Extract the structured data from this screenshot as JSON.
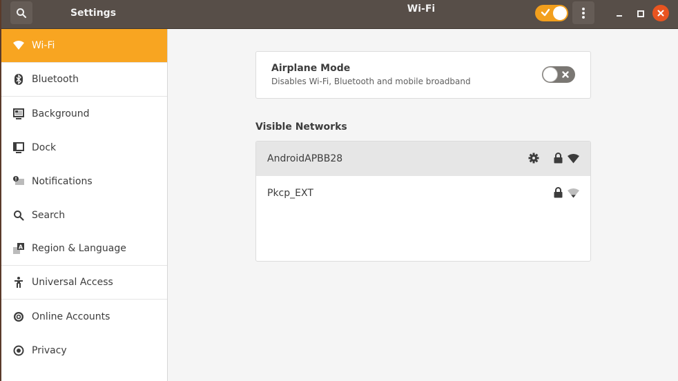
{
  "header": {
    "app_title": "Settings",
    "page_title": "Wi-Fi",
    "search_icon": "search-icon",
    "wifi_enabled": true,
    "menu_icon": "vertical-ellipsis-icon",
    "window_controls": [
      "minimize",
      "maximize",
      "close"
    ]
  },
  "sidebar": {
    "items": [
      {
        "label": "Wi-Fi",
        "icon": "wifi-icon",
        "active": true
      },
      {
        "label": "Bluetooth",
        "icon": "bluetooth-icon"
      },
      {
        "label": "Background",
        "icon": "background-icon"
      },
      {
        "label": "Dock",
        "icon": "dock-icon"
      },
      {
        "label": "Notifications",
        "icon": "notifications-icon"
      },
      {
        "label": "Search",
        "icon": "search-icon"
      },
      {
        "label": "Region & Language",
        "icon": "region-language-icon"
      },
      {
        "label": "Universal Access",
        "icon": "universal-access-icon"
      },
      {
        "label": "Online Accounts",
        "icon": "online-accounts-icon"
      },
      {
        "label": "Privacy",
        "icon": "privacy-icon"
      }
    ]
  },
  "airplane_mode": {
    "title": "Airplane Mode",
    "description": "Disables Wi-Fi, Bluetooth and mobile broadband",
    "enabled": false
  },
  "networks": {
    "section_title": "Visible Networks",
    "items": [
      {
        "name": "AndroidAPBB28",
        "connected": true,
        "secured": true,
        "signal": "excellent"
      },
      {
        "name": "Pkcp_EXT",
        "connected": false,
        "secured": true,
        "signal": "weak"
      }
    ]
  },
  "colors": {
    "accent": "#f8a521",
    "headerbar": "#574e48",
    "close": "#e95420"
  }
}
